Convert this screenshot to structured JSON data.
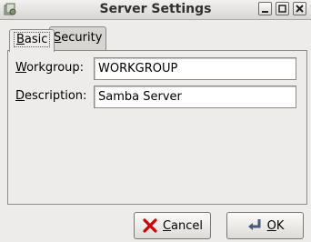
{
  "window": {
    "title": "Server Settings",
    "icon": "samba-settings-icon"
  },
  "tabs": [
    {
      "label": "Basic",
      "mnemonic": "B",
      "rest": "asic",
      "active": true
    },
    {
      "label": "Security",
      "mnemonic": "S",
      "rest": "ecurity",
      "active": false
    }
  ],
  "form": {
    "workgroup": {
      "label": "Workgroup:",
      "mnemonic": "W",
      "rest": "orkgroup:",
      "value": "WORKGROUP"
    },
    "description": {
      "label": "Description:",
      "mnemonic": "D",
      "rest": "escription:",
      "value": "Samba Server"
    }
  },
  "buttons": {
    "cancel": {
      "label": "Cancel",
      "mnemonic": "C",
      "rest": "ancel",
      "icon": "cancel-icon"
    },
    "ok": {
      "label": "OK",
      "mnemonic": "O",
      "rest": "K",
      "icon": "ok-arrow-icon"
    }
  },
  "colors": {
    "window_bg": "#edeceb",
    "titlebar": "#d8d6d3",
    "cancel_icon": "#cc0000"
  }
}
